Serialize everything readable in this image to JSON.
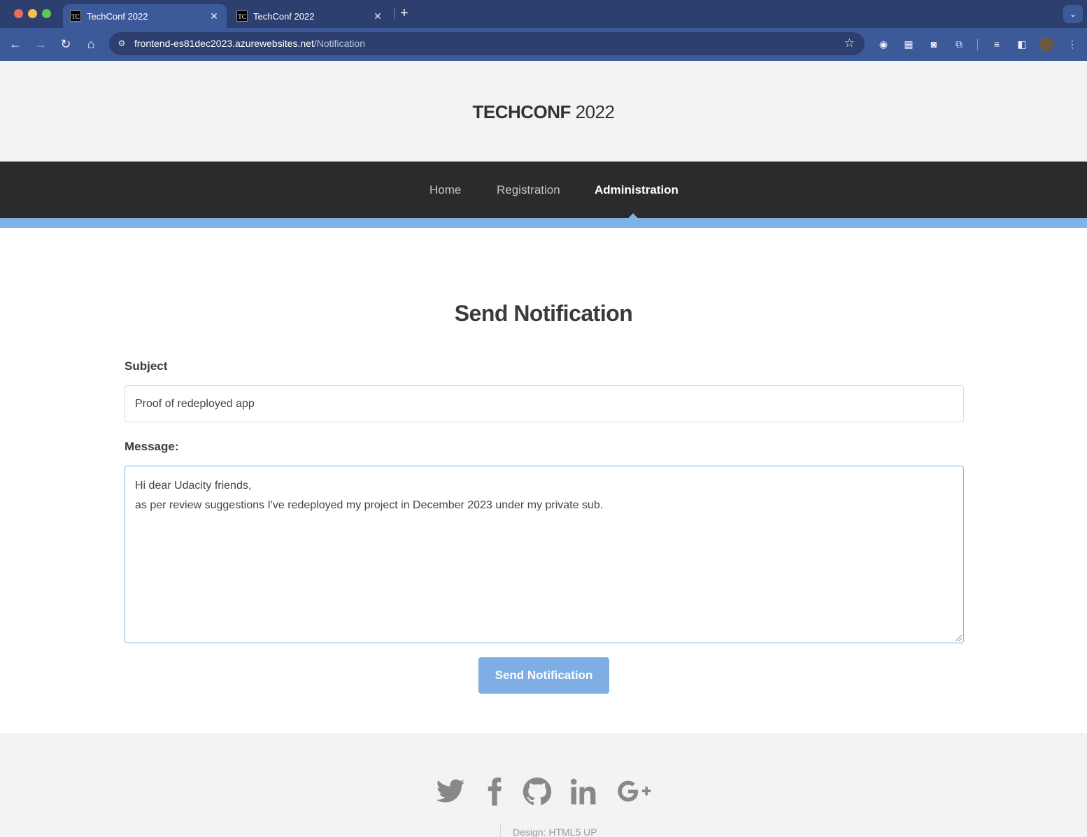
{
  "browser": {
    "tabs": [
      {
        "favicon": "TC",
        "title": "TechConf 2022",
        "active": true
      },
      {
        "favicon": "TC",
        "title": "TechConf 2022",
        "active": false
      }
    ],
    "url_host": "frontend-es81dec2023.azurewebsites.net",
    "url_path": "/Notification",
    "icons": [
      "back-icon",
      "forward-icon",
      "reload-icon",
      "home-icon",
      "site-info-icon",
      "bookmark-star-icon",
      "extension-icon",
      "menu-icon"
    ]
  },
  "site": {
    "title_bold": "TECHCONF",
    "title_year": " 2022"
  },
  "nav": {
    "items": [
      {
        "label": "Home"
      },
      {
        "label": "Registration"
      },
      {
        "label": "Administration"
      }
    ],
    "active": "Administration"
  },
  "form": {
    "heading": "Send Notification",
    "subject_label": "Subject",
    "subject_value": "Proof of redeployed app",
    "message_label": "Message:",
    "message_value": "Hi dear Udacity friends,\nas per review suggestions I've redeployed my project in December 2023 under my private sub.",
    "submit_label": "Send Notification"
  },
  "footer": {
    "social": [
      "twitter-icon",
      "facebook-icon",
      "github-icon",
      "linkedin-icon",
      "google-plus-icon"
    ],
    "credit": "Design: HTML5 UP"
  },
  "colors": {
    "accent": "#7eb3e8",
    "navbar": "#2b2b2b",
    "browser_frame": "#3c5a9a"
  }
}
